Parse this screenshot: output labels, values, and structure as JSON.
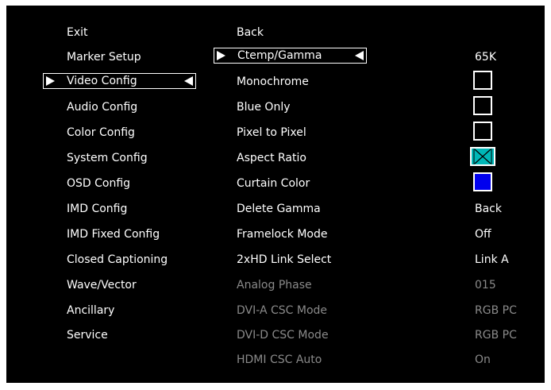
{
  "left_menu": {
    "items": [
      {
        "label": "Exit"
      },
      {
        "label": "Marker Setup"
      },
      {
        "label": "Video Config"
      },
      {
        "label": "Audio Config"
      },
      {
        "label": "Color Config"
      },
      {
        "label": "System Config"
      },
      {
        "label": "OSD Config"
      },
      {
        "label": "IMD Config"
      },
      {
        "label": "IMD Fixed Config"
      },
      {
        "label": "Closed Captioning"
      },
      {
        "label": "Wave/Vector"
      },
      {
        "label": "Ancillary"
      },
      {
        "label": "Service"
      }
    ],
    "selected": "Video Config"
  },
  "submenu": {
    "items": [
      {
        "label": "Back",
        "value": ""
      },
      {
        "label": "Ctemp/Gamma",
        "value": "65K"
      },
      {
        "label": "Monochrome",
        "value": ""
      },
      {
        "label": "Blue Only",
        "value": ""
      },
      {
        "label": "Pixel to Pixel",
        "value": ""
      },
      {
        "label": "Aspect Ratio",
        "value": ""
      },
      {
        "label": "Curtain Color",
        "value": ""
      },
      {
        "label": "Delete Gamma",
        "value": "Back"
      },
      {
        "label": "Framelock Mode",
        "value": "Off"
      },
      {
        "label": "2xHD Link Select",
        "value": "Link A"
      },
      {
        "label": "Analog Phase",
        "value": "015"
      },
      {
        "label": "DVI-A CSC Mode",
        "value": "RGB PC"
      },
      {
        "label": "DVI-D CSC Mode",
        "value": "RGB PC"
      },
      {
        "label": "HDMI CSC Auto",
        "value": "On"
      }
    ],
    "selected": "Ctemp/Gamma",
    "disabled": [
      "Analog Phase",
      "DVI-A CSC Mode",
      "DVI-D CSC Mode",
      "HDMI CSC Auto"
    ],
    "checkboxes": {
      "monochrome": false,
      "blue_only": false,
      "pixel_to_pixel": false
    },
    "aspect_ratio_icon": "x-marker-icon",
    "curtain_color": "#0000ee"
  },
  "colors": {
    "background": "#000000",
    "text": "#ffffff",
    "disabled_text": "#8a8a8a",
    "aspect_fill": "#00b7b7"
  }
}
